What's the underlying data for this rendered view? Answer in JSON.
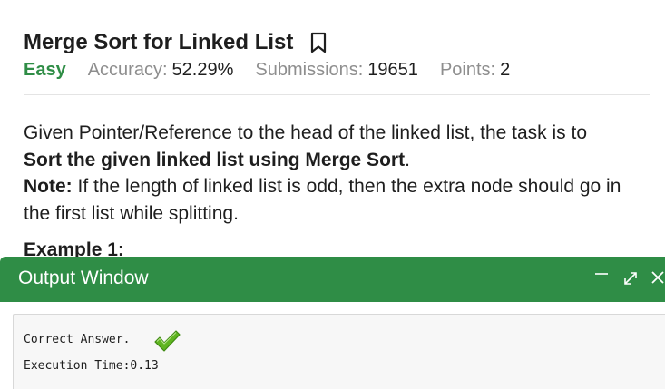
{
  "problem": {
    "title": "Merge Sort for Linked List",
    "difficulty": "Easy",
    "accuracy_label": "Accuracy:",
    "accuracy_value": "52.29%",
    "submissions_label": "Submissions:",
    "submissions_value": "19651",
    "points_label": "Points:",
    "points_value": "2",
    "icons": {
      "bookmark": "bookmark-icon"
    }
  },
  "statement": {
    "line1": "Given Pointer/Reference to the head of the linked list, the task is to",
    "bold_text": "Sort the given linked list using Merge Sort",
    "bold_suffix": ".",
    "note_label": "Note:",
    "note_text": " If the length of linked list is odd, then the extra node should go in the first list while splitting.",
    "example_heading": "Example 1:"
  },
  "output_window": {
    "title": "Output Window",
    "result_text": "Correct Answer.",
    "execution_time": "Execution Time:0.13",
    "icons": {
      "minimize": "minimize-icon",
      "maximize": "maximize-icon",
      "close": "close-icon",
      "check": "checkmark-icon"
    }
  },
  "colors": {
    "accent_green": "#2f8d46",
    "meta_gray": "#8e8e8e",
    "text_dark": "#1e1e1e",
    "output_bg": "#f7f7f7",
    "check_green": "#5fb520"
  }
}
